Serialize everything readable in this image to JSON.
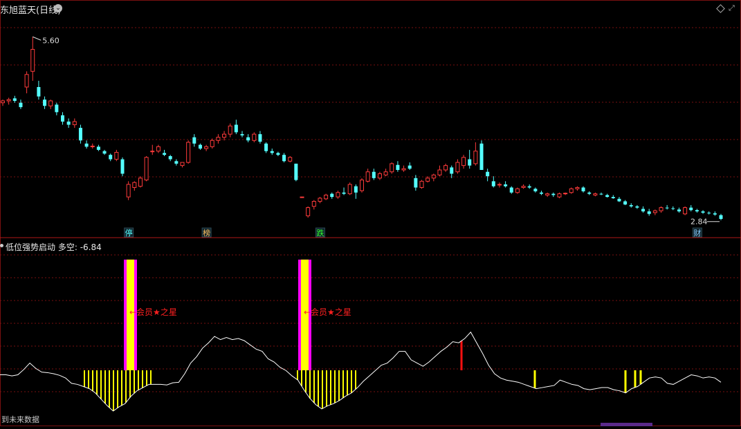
{
  "header": {
    "title": "东旭蓝天(日线)",
    "chevron": "chevron-down-icon"
  },
  "indicator": {
    "name": "低位强势启动",
    "value_label": "多空: -6.84"
  },
  "footer": {
    "text": "到未来数据"
  },
  "colors": {
    "up": "#ff3b3b",
    "down": "#54ffff",
    "grid": "#7a1010",
    "yellow": "#ffff00",
    "magenta": "#ff00ff",
    "line": "#ffffff"
  },
  "chart_data": [
    {
      "type": "candlestick",
      "high_label": "5.60",
      "low_label": "2.84",
      "ylim": [
        2.6,
        5.9
      ],
      "candles": [
        [
          4.55,
          4.6,
          4.5,
          4.58
        ],
        [
          4.58,
          4.63,
          4.52,
          4.6
        ],
        [
          4.62,
          4.66,
          4.55,
          4.58
        ],
        [
          4.55,
          4.6,
          4.45,
          4.48
        ],
        [
          4.8,
          5.05,
          4.7,
          5.0
        ],
        [
          5.05,
          5.6,
          4.9,
          5.4
        ],
        [
          4.8,
          4.9,
          4.6,
          4.65
        ],
        [
          4.6,
          4.65,
          4.45,
          4.5
        ],
        [
          4.5,
          4.6,
          4.45,
          4.58
        ],
        [
          4.52,
          4.55,
          4.35,
          4.4
        ],
        [
          4.35,
          4.4,
          4.2,
          4.25
        ],
        [
          4.25,
          4.3,
          4.15,
          4.2
        ],
        [
          4.2,
          4.3,
          4.15,
          4.25
        ],
        [
          4.15,
          4.2,
          3.9,
          3.95
        ],
        [
          3.9,
          3.95,
          3.82,
          3.85
        ],
        [
          3.85,
          3.9,
          3.82,
          3.86
        ],
        [
          3.85,
          3.88,
          3.78,
          3.8
        ],
        [
          3.78,
          3.8,
          3.72,
          3.74
        ],
        [
          3.72,
          3.74,
          3.62,
          3.65
        ],
        [
          3.65,
          3.8,
          3.62,
          3.76
        ],
        [
          3.65,
          3.68,
          3.38,
          3.42
        ],
        [
          3.05,
          3.3,
          3.0,
          3.25
        ],
        [
          3.2,
          3.3,
          3.15,
          3.28
        ],
        [
          3.22,
          3.38,
          3.2,
          3.35
        ],
        [
          3.32,
          3.7,
          3.3,
          3.68
        ],
        [
          3.77,
          3.88,
          3.72,
          3.78
        ],
        [
          3.78,
          3.88,
          3.75,
          3.85
        ],
        [
          3.75,
          3.8,
          3.7,
          3.72
        ],
        [
          3.7,
          3.72,
          3.62,
          3.65
        ],
        [
          3.62,
          3.65,
          3.55,
          3.58
        ],
        [
          3.55,
          3.6,
          3.52,
          3.6
        ],
        [
          3.6,
          3.95,
          3.58,
          3.92
        ],
        [
          4.0,
          4.05,
          3.85,
          3.9
        ],
        [
          3.88,
          3.9,
          3.8,
          3.82
        ],
        [
          3.82,
          3.88,
          3.78,
          3.85
        ],
        [
          3.85,
          3.98,
          3.82,
          3.95
        ],
        [
          3.95,
          4.05,
          3.9,
          4.0
        ],
        [
          4.0,
          4.1,
          3.95,
          4.05
        ],
        [
          4.05,
          4.22,
          4.0,
          4.18
        ],
        [
          4.2,
          4.28,
          4.05,
          4.08
        ],
        [
          4.05,
          4.1,
          4.0,
          4.03
        ],
        [
          4.0,
          4.05,
          3.92,
          3.95
        ],
        [
          3.95,
          4.08,
          3.92,
          4.05
        ],
        [
          4.05,
          4.1,
          3.9,
          3.93
        ],
        [
          3.9,
          3.92,
          3.75,
          3.78
        ],
        [
          3.78,
          3.82,
          3.72,
          3.75
        ],
        [
          3.75,
          3.77,
          3.7,
          3.72
        ],
        [
          3.72,
          3.75,
          3.6,
          3.62
        ],
        [
          3.62,
          3.7,
          3.6,
          3.68
        ],
        [
          3.58,
          3.58,
          3.3,
          3.32
        ],
        [
          3.05,
          3.05,
          3.05,
          3.05
        ],
        [
          2.75,
          2.9,
          2.72,
          2.88
        ],
        [
          2.9,
          3.0,
          2.85,
          2.98
        ],
        [
          2.98,
          3.05,
          2.95,
          3.03
        ],
        [
          3.02,
          3.1,
          3.0,
          3.08
        ],
        [
          3.1,
          3.12,
          3.02,
          3.05
        ],
        [
          3.05,
          3.15,
          3.02,
          3.12
        ],
        [
          3.12,
          3.2,
          3.08,
          3.1
        ],
        [
          3.1,
          3.28,
          3.08,
          3.25
        ],
        [
          3.22,
          3.25,
          3.02,
          3.12
        ],
        [
          3.15,
          3.35,
          3.12,
          3.32
        ],
        [
          3.3,
          3.5,
          3.28,
          3.45
        ],
        [
          3.45,
          3.5,
          3.32,
          3.35
        ],
        [
          3.35,
          3.45,
          3.32,
          3.42
        ],
        [
          3.4,
          3.5,
          3.38,
          3.45
        ],
        [
          3.45,
          3.6,
          3.42,
          3.58
        ],
        [
          3.56,
          3.62,
          3.45,
          3.48
        ],
        [
          3.48,
          3.55,
          3.45,
          3.5
        ],
        [
          3.55,
          3.6,
          3.48,
          3.5
        ],
        [
          3.35,
          3.4,
          3.15,
          3.2
        ],
        [
          3.2,
          3.32,
          3.18,
          3.3
        ],
        [
          3.3,
          3.38,
          3.28,
          3.35
        ],
        [
          3.35,
          3.42,
          3.3,
          3.4
        ],
        [
          3.4,
          3.55,
          3.38,
          3.48
        ],
        [
          3.48,
          3.58,
          3.45,
          3.55
        ],
        [
          3.52,
          3.55,
          3.35,
          3.42
        ],
        [
          3.45,
          3.65,
          3.42,
          3.6
        ],
        [
          3.55,
          3.72,
          3.5,
          3.68
        ],
        [
          3.65,
          3.8,
          3.5,
          3.55
        ],
        [
          3.58,
          3.92,
          3.55,
          3.78
        ],
        [
          3.9,
          3.95,
          3.55,
          3.48
        ],
        [
          3.45,
          3.5,
          3.3,
          3.38
        ],
        [
          3.3,
          3.38,
          3.2,
          3.22
        ],
        [
          3.25,
          3.28,
          3.2,
          3.25
        ],
        [
          3.25,
          3.3,
          3.2,
          3.22
        ],
        [
          3.2,
          3.22,
          3.1,
          3.12
        ],
        [
          3.12,
          3.2,
          3.1,
          3.18
        ],
        [
          3.2,
          3.25,
          3.18,
          3.22
        ],
        [
          3.22,
          3.25,
          3.18,
          3.2
        ],
        [
          3.18,
          3.2,
          3.12,
          3.14
        ],
        [
          3.12,
          3.15,
          3.08,
          3.1
        ],
        [
          3.08,
          3.12,
          3.05,
          3.1
        ],
        [
          3.1,
          3.12,
          3.05,
          3.08
        ],
        [
          3.05,
          3.12,
          3.03,
          3.1
        ],
        [
          3.1,
          3.12,
          3.08,
          3.11
        ],
        [
          3.12,
          3.2,
          3.1,
          3.18
        ],
        [
          3.18,
          3.22,
          3.15,
          3.2
        ],
        [
          3.2,
          3.22,
          3.12,
          3.14
        ],
        [
          3.12,
          3.14,
          3.08,
          3.1
        ],
        [
          3.08,
          3.12,
          3.06,
          3.1
        ],
        [
          3.1,
          3.12,
          3.08,
          3.09
        ],
        [
          3.08,
          3.1,
          3.04,
          3.05
        ],
        [
          3.05,
          3.08,
          3.02,
          3.03
        ],
        [
          3.02,
          3.05,
          2.97,
          2.98
        ],
        [
          2.98,
          3.0,
          2.92,
          2.93
        ],
        [
          2.92,
          2.95,
          2.88,
          2.9
        ],
        [
          2.9,
          2.92,
          2.86,
          2.88
        ],
        [
          2.86,
          2.9,
          2.8,
          2.82
        ],
        [
          2.82,
          2.86,
          2.75,
          2.78
        ],
        [
          2.8,
          2.85,
          2.76,
          2.83
        ],
        [
          2.83,
          2.9,
          2.8,
          2.88
        ],
        [
          2.88,
          2.92,
          2.85,
          2.87
        ],
        [
          2.87,
          2.9,
          2.84,
          2.86
        ],
        [
          2.85,
          2.88,
          2.8,
          2.82
        ],
        [
          2.78,
          2.9,
          2.76,
          2.88
        ],
        [
          2.88,
          2.92,
          2.82,
          2.84
        ],
        [
          2.84,
          2.86,
          2.8,
          2.82
        ],
        [
          2.82,
          2.84,
          2.78,
          2.8
        ],
        [
          2.8,
          2.82,
          2.77,
          2.79
        ],
        [
          2.79,
          2.82,
          2.75,
          2.77
        ],
        [
          2.76,
          2.78,
          2.68,
          2.7
        ]
      ],
      "markers": [
        {
          "index": 21,
          "text": "停",
          "color": "#54ffff"
        },
        {
          "index": 34,
          "text": "榜",
          "color": "#ffc060"
        },
        {
          "index": 53,
          "text": "跌",
          "color": "#30ff30"
        },
        {
          "index": 116,
          "text": "财",
          "color": "#88ccff"
        }
      ]
    },
    {
      "type": "indicator",
      "name": "低位强势启动",
      "value": -6.84,
      "line": [
        -3.0,
        -3.0,
        -3.2,
        -3.0,
        -2.0,
        -0.8,
        -1.8,
        -2.5,
        -2.6,
        -2.8,
        -3.1,
        -3.6,
        -4.6,
        -4.8,
        -5.2,
        -5.6,
        -6.4,
        -7.6,
        -8.8,
        -9.8,
        -9.0,
        -8.4,
        -7.0,
        -6.0,
        -5.4,
        -4.8,
        -4.8,
        -4.8,
        -4.9,
        -4.5,
        -4.4,
        -2.8,
        -0.8,
        0.4,
        2.0,
        3.0,
        4.2,
        3.6,
        4.0,
        3.6,
        3.8,
        3.4,
        2.6,
        1.8,
        1.4,
        0.0,
        -0.6,
        -1.6,
        -2.2,
        -3.2,
        -4.0,
        -5.8,
        -7.4,
        -8.6,
        -9.4,
        -8.8,
        -8.4,
        -7.8,
        -7.0,
        -6.4,
        -5.4,
        -4.2,
        -3.2,
        -2.2,
        -1.2,
        -0.8,
        0.2,
        1.4,
        1.4,
        -0.2,
        -0.8,
        -1.4,
        -0.6,
        0.4,
        1.4,
        2.2,
        3.2,
        3.0,
        3.8,
        5.0,
        3.0,
        1.0,
        -1.2,
        -2.8,
        -3.6,
        -4.0,
        -4.2,
        -4.4,
        -4.8,
        -5.2,
        -5.6,
        -5.4,
        -5.2,
        -5.0,
        -4.0,
        -4.4,
        -4.8,
        -5.0,
        -5.6,
        -5.8,
        -5.6,
        -5.4,
        -5.4,
        -5.8,
        -6.0,
        -6.4,
        -5.6,
        -5.2,
        -4.4,
        -3.6,
        -3.4,
        -3.6,
        -4.6,
        -4.8,
        -4.2,
        -3.6,
        -3.0,
        -3.2,
        -3.6,
        -3.4,
        -3.6,
        -4.4
      ],
      "ylim": [
        -12,
        20
      ],
      "magenta_bars": [
        [
          179,
          198
        ],
        [
          431,
          450
        ]
      ],
      "magenta_top": 18.6,
      "yellow_regions": [
        [
          122,
          221
        ],
        [
          430,
          515
        ]
      ],
      "yellow_single_bars": [
        773,
        904,
        918,
        926
      ],
      "red_bar": {
        "x": 667
      },
      "annotation": "←会员★之星"
    }
  ]
}
